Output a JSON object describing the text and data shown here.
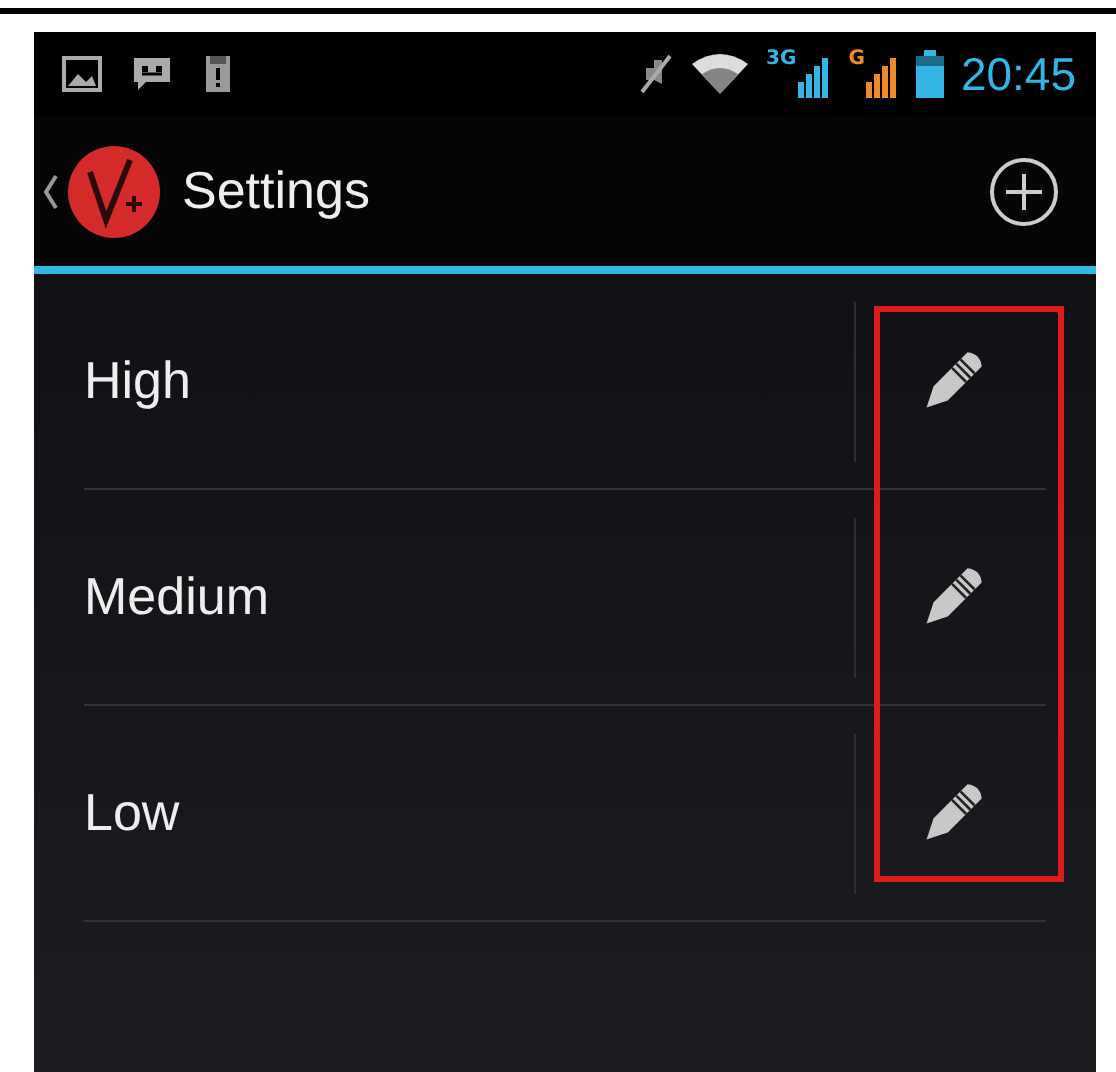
{
  "status_bar": {
    "network_labels": [
      "3G",
      "G"
    ],
    "time": "20:45"
  },
  "action_bar": {
    "title": "Settings"
  },
  "rows": [
    {
      "label": "High"
    },
    {
      "label": "Medium"
    },
    {
      "label": "Low"
    }
  ]
}
